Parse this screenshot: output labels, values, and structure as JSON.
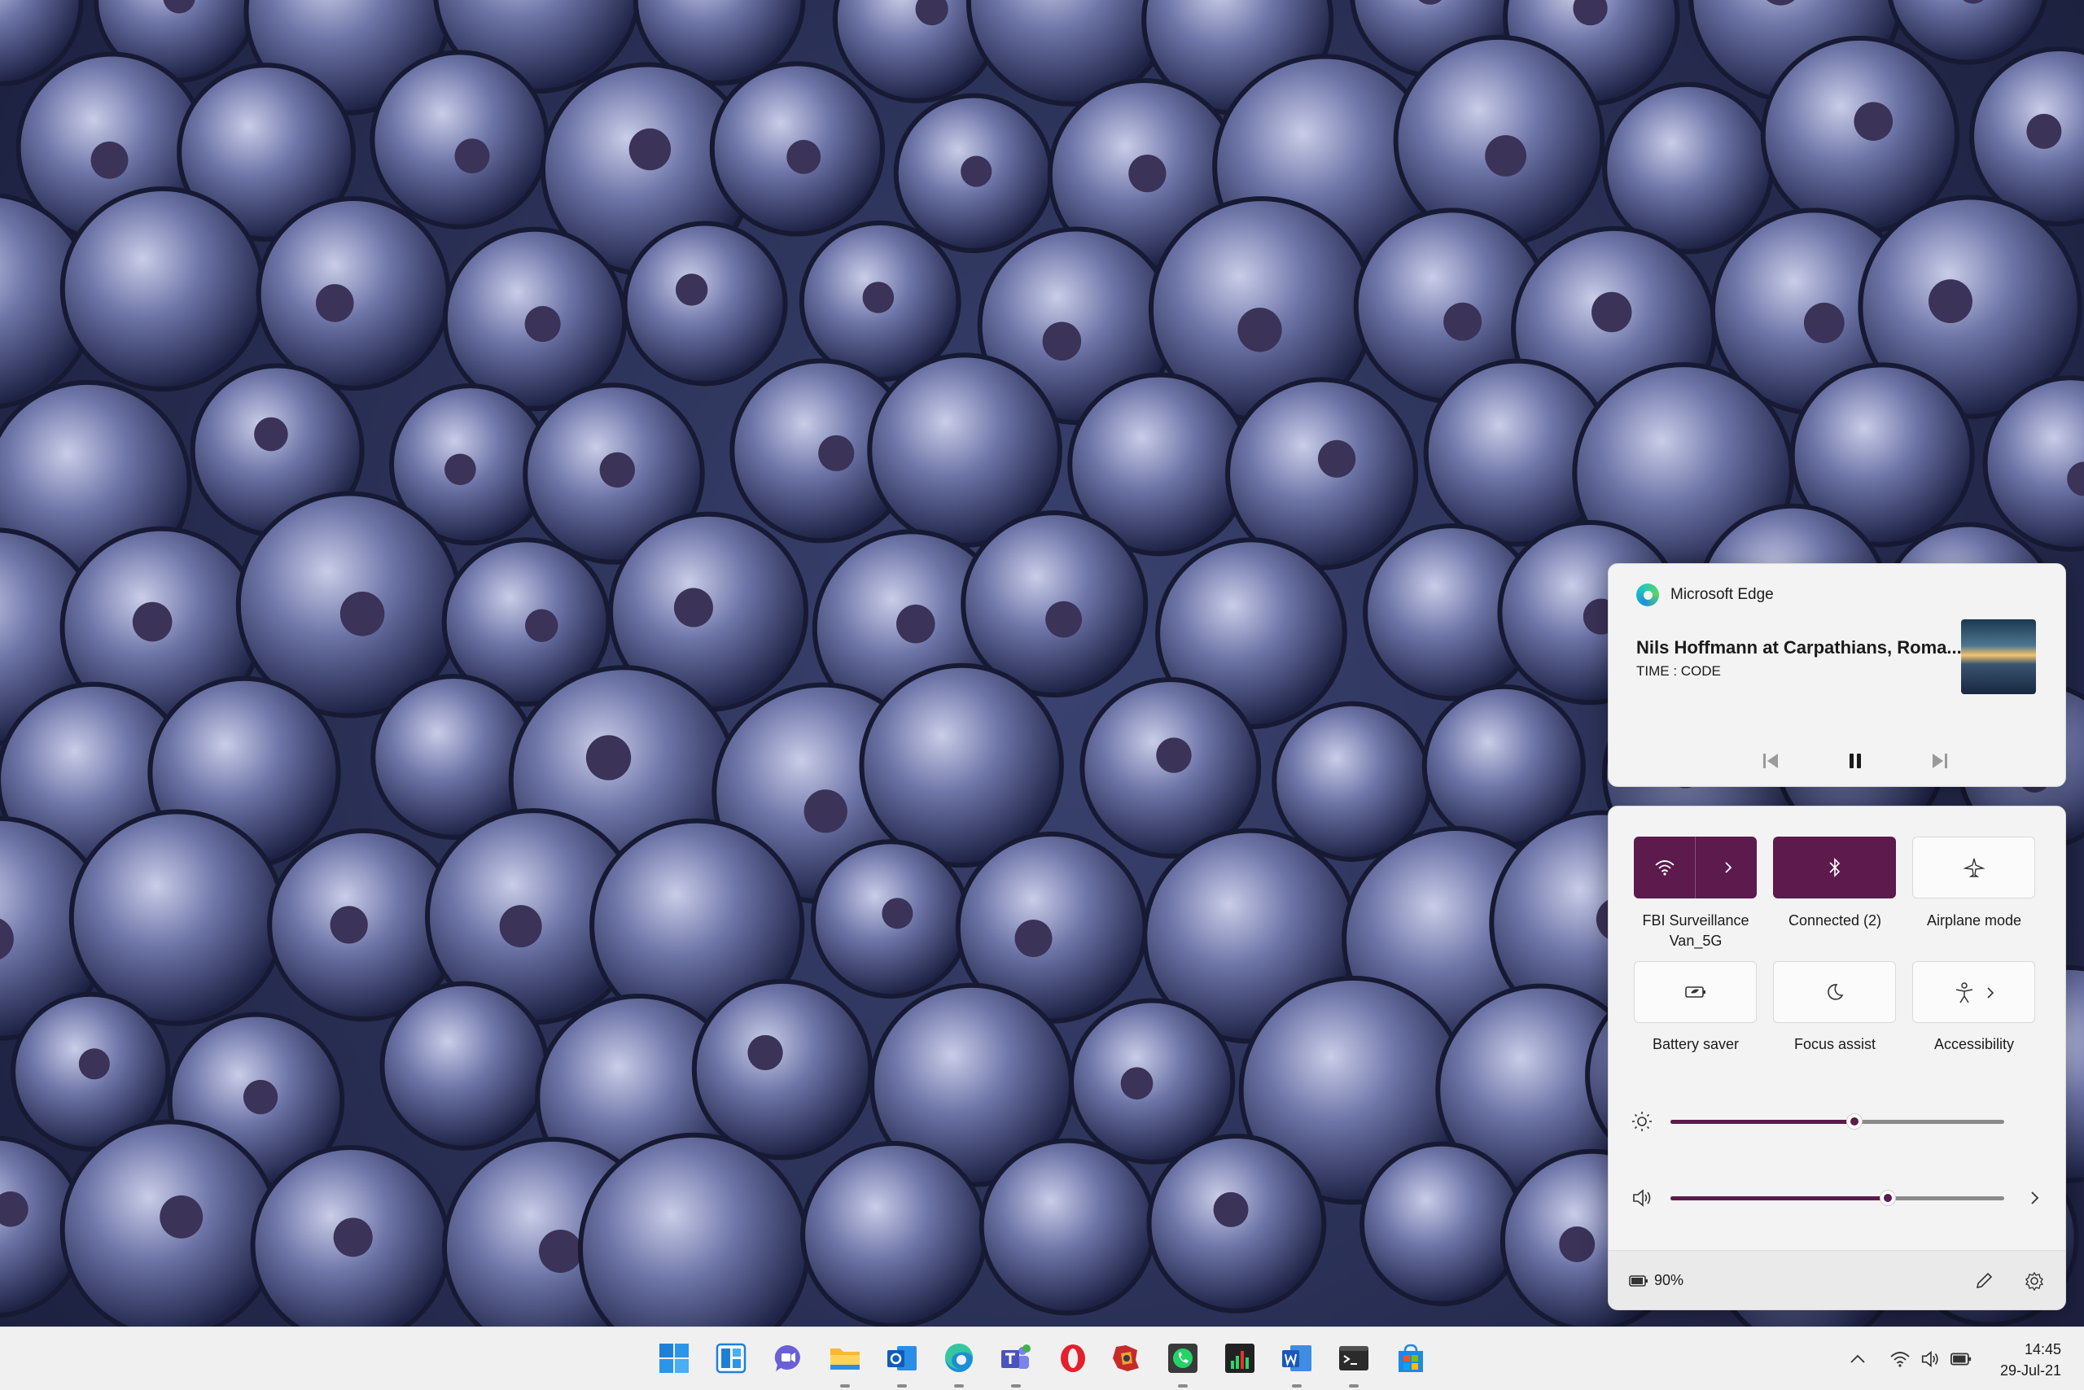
{
  "media": {
    "app_name": "Microsoft Edge",
    "title": "Nils Hoffmann at Carpathians, Roma...",
    "artist": "TIME : CODE",
    "controls": {
      "previous": "previous-track",
      "pause": "pause",
      "next": "next-track"
    }
  },
  "quick_settings": {
    "tiles": [
      {
        "label": "FBI Surveillance Van_5G",
        "icon": "wifi-icon",
        "state": "on"
      },
      {
        "label": "Connected (2)",
        "icon": "bluetooth-icon",
        "state": "on"
      },
      {
        "label": "Airplane mode",
        "icon": "airplane-icon",
        "state": "off"
      },
      {
        "label": "Battery saver",
        "icon": "battery-saver-icon",
        "state": "off"
      },
      {
        "label": "Focus assist",
        "icon": "moon-icon",
        "state": "off"
      },
      {
        "label": "Accessibility",
        "icon": "accessibility-icon",
        "state": "off"
      }
    ],
    "brightness_level": 0.55,
    "volume_level": 0.65,
    "battery": "90%"
  },
  "taskbar": {
    "apps": [
      "start-icon",
      "widgets-icon",
      "chat-icon",
      "file-explorer-icon",
      "outlook-icon",
      "edge-icon",
      "teams-icon",
      "opera-icon",
      "puzzle-app-icon",
      "whatsapp-icon",
      "task-manager-icon",
      "word-icon",
      "terminal-icon",
      "store-icon"
    ],
    "time": "14:45",
    "date": "29-Jul-21"
  },
  "colors": {
    "accent": "#5c1a4d",
    "flyout_bg": "#f3f3f3",
    "taskbar_bg": "#f0f0f0"
  }
}
